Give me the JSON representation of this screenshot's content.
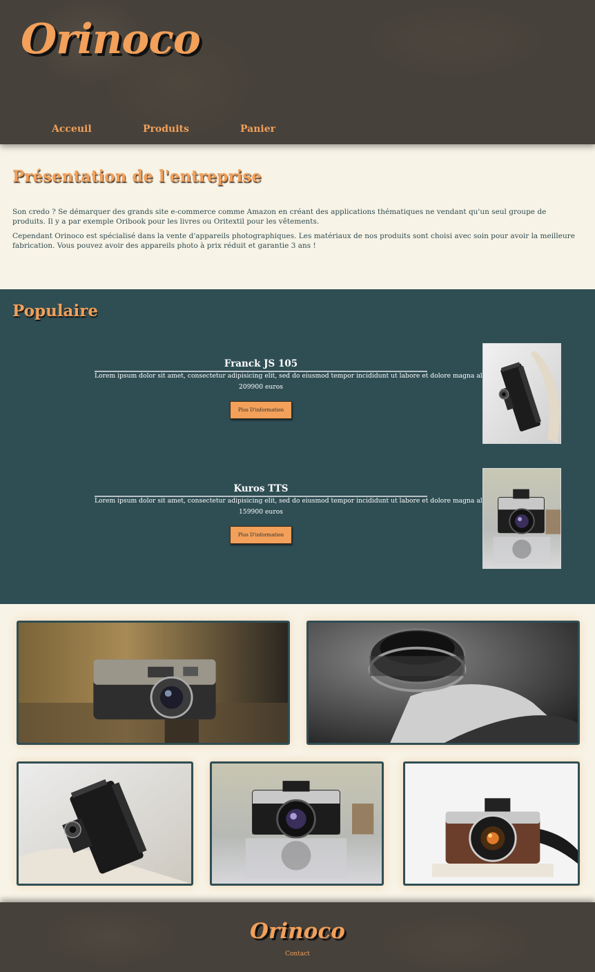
{
  "header": {
    "logo": "Orinoco",
    "nav": [
      {
        "label": "Acceuil"
      },
      {
        "label": "Produits"
      },
      {
        "label": "Panier"
      }
    ]
  },
  "presentation": {
    "title": "Présentation de l'entreprise",
    "paragraphs": [
      "Son credo ? Se démarquer des grands site e-commerce comme Amazon en créant des applications thématiques ne vendant qu'un seul groupe de produits. Il y a par exemple Oribook pour les livres ou Oritextil pour les vêtements.",
      "Cependant Orinoco est spécialisé dans la vente d'appareils photographiques. Les matériaux de nos produits sont choisi avec soin pour avoir la meilleure fabrication. Vous pouvez avoir des appareils photo à prix réduit et garantie 3 ans !"
    ]
  },
  "populaire": {
    "title": "Populaire",
    "products": [
      {
        "name": "Franck JS 105",
        "description": "Lorem ipsum dolor sit amet, consectetur adipisicing elit, sed do eiusmod tempor incididunt ut labore et dolore magna aliqua.",
        "price": "209900 euros",
        "button_label": "Plus D'information",
        "image_icon": "folding-camera-photo"
      },
      {
        "name": "Kuros TTS",
        "description": "Lorem ipsum dolor sit amet, consectetur adipisicing elit, sed do eiusmod tempor incididunt ut labore et dolore magna aliqua.",
        "price": "159900 euros",
        "button_label": "Plus D'information",
        "image_icon": "minolta-camera-photo"
      }
    ]
  },
  "gallery": {
    "images": [
      {
        "icon": "vintage-rangefinder-camera-photo"
      },
      {
        "icon": "camera-lens-closeup-photo"
      },
      {
        "icon": "folding-camera-photo"
      },
      {
        "icon": "minolta-camera-photo"
      },
      {
        "icon": "brown-film-camera-photo"
      }
    ]
  },
  "footer": {
    "logo": "Orinoco",
    "link": "Contact"
  },
  "colors": {
    "accent": "#f2a05a",
    "header_bg": "#46413a",
    "teal": "#2f4e54",
    "cream": "#f7f3e6"
  }
}
